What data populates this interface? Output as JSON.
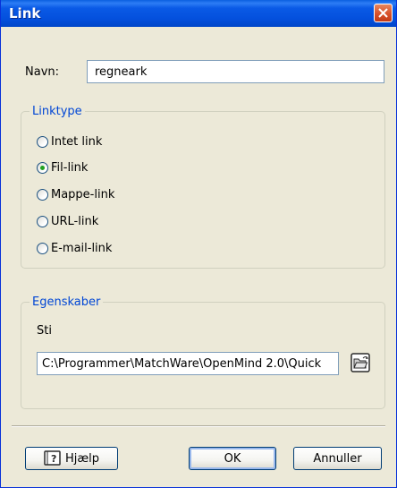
{
  "window": {
    "title": "Link"
  },
  "name_field": {
    "label": "Navn:",
    "value": "regneark"
  },
  "link_type_group": {
    "legend": "Linktype",
    "options": [
      {
        "label": "Intet link",
        "checked": false
      },
      {
        "label": "Fil-link",
        "checked": true
      },
      {
        "label": "Mappe-link",
        "checked": false
      },
      {
        "label": "URL-link",
        "checked": false
      },
      {
        "label": "E-mail-link",
        "checked": false
      }
    ]
  },
  "properties_group": {
    "legend": "Egenskaber",
    "path_label": "Sti",
    "path_value": "C:\\Programmer\\MatchWare\\OpenMind 2.0\\Quick"
  },
  "buttons": {
    "help": "Hjælp",
    "ok": "OK",
    "cancel": "Annuller"
  },
  "icons": {
    "close": "close-icon",
    "browse": "open-folder-icon",
    "help": "help-book-icon"
  },
  "colors": {
    "titlebar": "#0a5ae6",
    "accent_legend": "#0046d5",
    "radio_checked": "#21a121",
    "close_button": "#d8512a"
  }
}
